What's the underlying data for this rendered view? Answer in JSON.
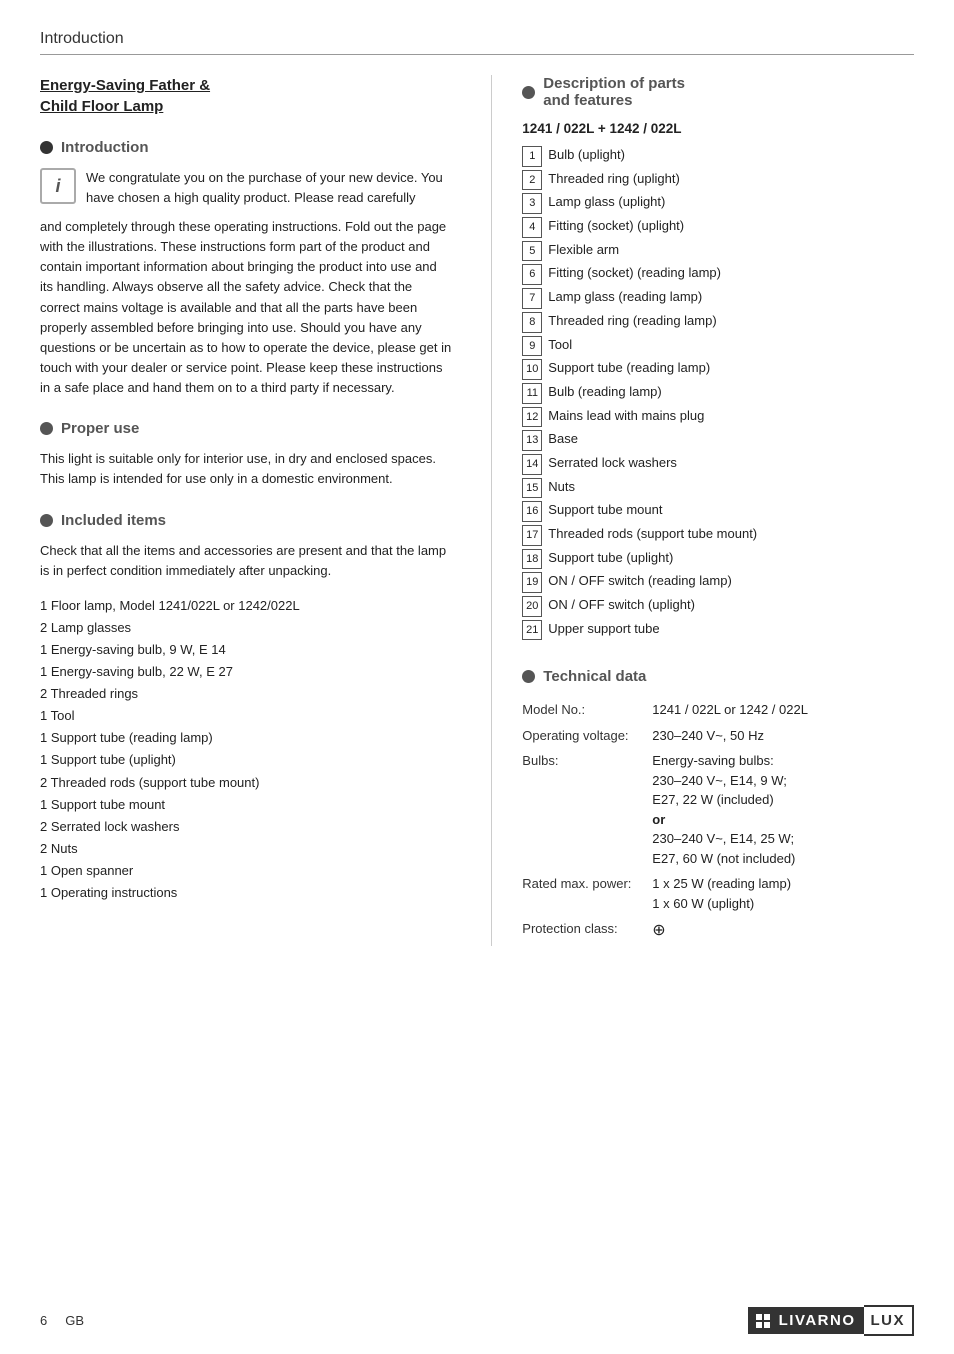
{
  "header": {
    "title": "Introduction"
  },
  "left": {
    "product_title": "Energy-Saving Father &\nChild Floor Lamp",
    "sections": [
      {
        "id": "introduction",
        "heading": "Introduction",
        "info_text": "We congratulate you on the purchase of your new device. You have chosen a high quality product. Please read carefully and completely through these operating instructions. Fold out the page with the illustrations. These instructions form part of the product and contain important information about bringing the product into use and its handling. Always observe all the safety advice. Check that the correct mains voltage is available and that all the parts have been properly assembled before bringing into use. Should you have any questions or be uncertain as to how to operate the device, please get in touch with your dealer or service point. Please keep these instructions in a safe place and hand them on to a third party if necessary."
      },
      {
        "id": "proper-use",
        "heading": "Proper use",
        "body": "This light is suitable only for interior use, in dry and enclosed spaces. This lamp is intended for use only in a domestic environment."
      },
      {
        "id": "included-items",
        "heading": "Included items",
        "intro": "Check that all the items and accessories are present and that the lamp is in perfect condition immediately after unpacking.",
        "items": [
          "1 Floor lamp, Model 1241/022L or 1242/022L",
          "2 Lamp glasses",
          "1 Energy-saving bulb, 9 W, E 14",
          "1 Energy-saving bulb, 22 W, E 27",
          "2 Threaded rings",
          "1 Tool",
          "1 Support tube (reading lamp)",
          "1 Support tube (uplight)",
          "2 Threaded rods (support tube mount)",
          "1 Support tube mount",
          "2 Serrated lock washers",
          "2 Nuts",
          "1 Open spanner",
          "1 Operating instructions"
        ]
      }
    ]
  },
  "right": {
    "description_heading": "Description of parts\nand features",
    "model_label": "1241 / 022L + 1242 / 022L",
    "parts": [
      {
        "num": "1",
        "label": "Bulb (uplight)"
      },
      {
        "num": "2",
        "label": "Threaded ring (uplight)"
      },
      {
        "num": "3",
        "label": "Lamp glass (uplight)"
      },
      {
        "num": "4",
        "label": "Fitting (socket) (uplight)"
      },
      {
        "num": "5",
        "label": "Flexible arm"
      },
      {
        "num": "6",
        "label": "Fitting (socket) (reading lamp)"
      },
      {
        "num": "7",
        "label": "Lamp glass (reading lamp)"
      },
      {
        "num": "8",
        "label": "Threaded ring (reading lamp)"
      },
      {
        "num": "9",
        "label": "Tool"
      },
      {
        "num": "10",
        "label": "Support tube (reading lamp)"
      },
      {
        "num": "11",
        "label": "Bulb (reading lamp)"
      },
      {
        "num": "12",
        "label": "Mains lead with mains plug"
      },
      {
        "num": "13",
        "label": "Base"
      },
      {
        "num": "14",
        "label": "Serrated lock washers"
      },
      {
        "num": "15",
        "label": "Nuts"
      },
      {
        "num": "16",
        "label": "Support tube mount"
      },
      {
        "num": "17",
        "label": "Threaded rods (support tube mount)"
      },
      {
        "num": "18",
        "label": "Support tube (uplight)"
      },
      {
        "num": "19",
        "label": "ON / OFF switch (reading lamp)"
      },
      {
        "num": "20",
        "label": "ON / OFF switch (uplight)"
      },
      {
        "num": "21",
        "label": "Upper support tube"
      }
    ],
    "technical": {
      "heading": "Technical data",
      "rows": [
        {
          "label": "Model No.:",
          "value": "1241 / 022L or 1242 / 022L"
        },
        {
          "label": "Operating voltage:",
          "value": "230–240 V~, 50 Hz"
        },
        {
          "label": "Bulbs:",
          "value": "Energy-saving bulbs:\n230–240 V~, E14, 9 W;\nE27, 22 W (included)\nor\n230–240 V~, E14, 25 W;\nE27, 60 W (not included)"
        },
        {
          "label": "Rated max. power:",
          "value": "1 x 25 W (reading lamp)\n1 x 60 W (uplight)"
        },
        {
          "label": "Protection class:",
          "value": "⊕"
        }
      ]
    }
  },
  "footer": {
    "page": "6",
    "lang": "GB",
    "logo_name": "LIVARNO",
    "logo_suffix": "LUX"
  }
}
